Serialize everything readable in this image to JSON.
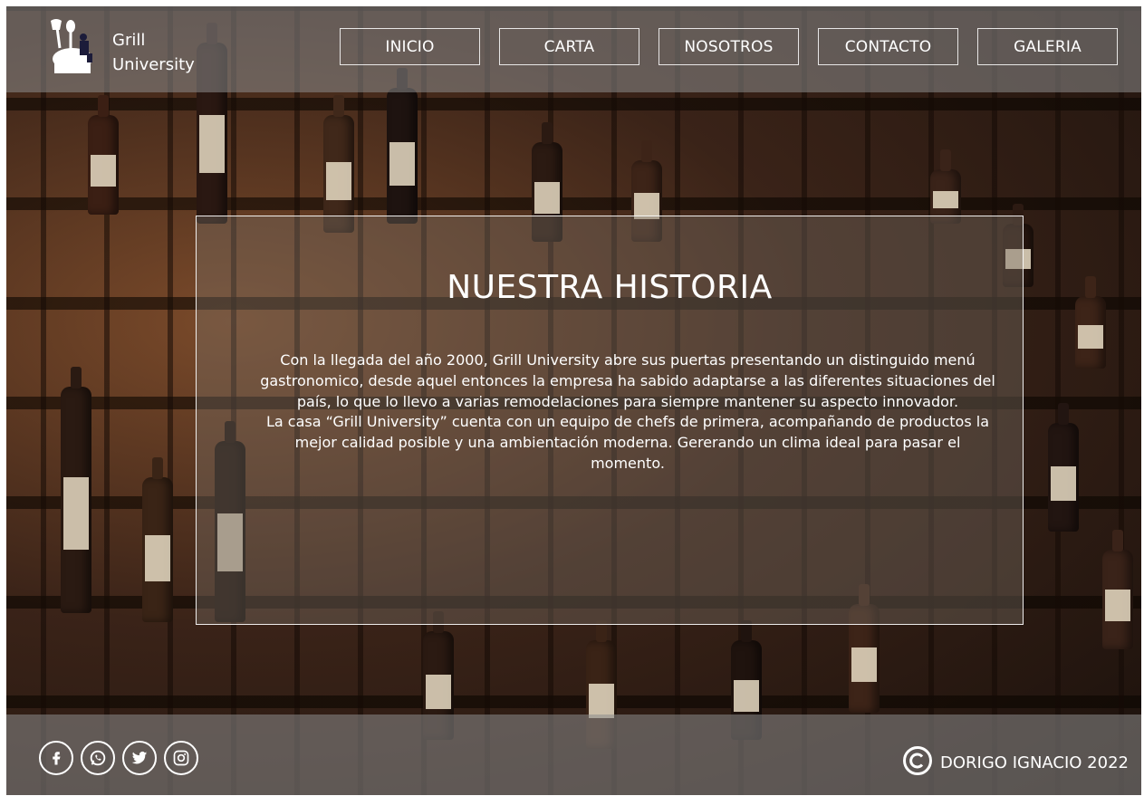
{
  "brand": {
    "line1": "Grill",
    "line2": "University"
  },
  "nav": {
    "items": [
      "INICIO",
      "CARTA",
      "NOSOTROS",
      "CONTACTO",
      "GALERIA"
    ]
  },
  "story": {
    "title": "NUESTRA HISTORIA",
    "paragraph1": "Con la llegada del año 2000, Grill University abre sus puertas presentando un distinguido menú gastronomico, desde aquel entonces la empresa ha sabido adaptarse a las diferentes situaciones del país, lo que lo llevo a varias remodelaciones para siempre mantener su aspecto innovador.",
    "paragraph2": "La casa “Grill University” cuenta con un equipo de chefs de primera, acompañando de productos la mejor calidad posible y una ambientación moderna. Gererando un clima ideal para pasar el momento."
  },
  "footer": {
    "social_icons": [
      "facebook-icon",
      "whatsapp-icon",
      "twitter-icon",
      "instagram-icon"
    ],
    "copyright_text": "DORIGO IGNACIO 2022"
  },
  "colors": {
    "overlay": "#8c8c8c",
    "text": "#ffffff",
    "background_dark": "#1b110c",
    "background_warm": "#7a4a2a"
  }
}
